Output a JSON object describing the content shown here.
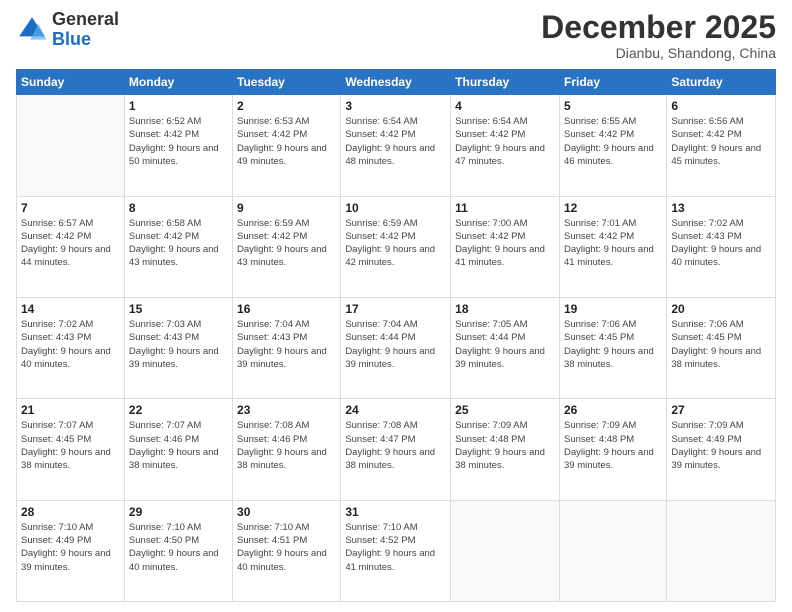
{
  "logo": {
    "general": "General",
    "blue": "Blue"
  },
  "title": "December 2025",
  "subtitle": "Dianbu, Shandong, China",
  "days_of_week": [
    "Sunday",
    "Monday",
    "Tuesday",
    "Wednesday",
    "Thursday",
    "Friday",
    "Saturday"
  ],
  "weeks": [
    [
      {
        "day": "",
        "empty": true
      },
      {
        "day": "1",
        "sunrise": "6:52 AM",
        "sunset": "4:42 PM",
        "daylight": "9 hours and 50 minutes."
      },
      {
        "day": "2",
        "sunrise": "6:53 AM",
        "sunset": "4:42 PM",
        "daylight": "9 hours and 49 minutes."
      },
      {
        "day": "3",
        "sunrise": "6:54 AM",
        "sunset": "4:42 PM",
        "daylight": "9 hours and 48 minutes."
      },
      {
        "day": "4",
        "sunrise": "6:54 AM",
        "sunset": "4:42 PM",
        "daylight": "9 hours and 47 minutes."
      },
      {
        "day": "5",
        "sunrise": "6:55 AM",
        "sunset": "4:42 PM",
        "daylight": "9 hours and 46 minutes."
      },
      {
        "day": "6",
        "sunrise": "6:56 AM",
        "sunset": "4:42 PM",
        "daylight": "9 hours and 45 minutes."
      }
    ],
    [
      {
        "day": "7",
        "sunrise": "6:57 AM",
        "sunset": "4:42 PM",
        "daylight": "9 hours and 44 minutes."
      },
      {
        "day": "8",
        "sunrise": "6:58 AM",
        "sunset": "4:42 PM",
        "daylight": "9 hours and 43 minutes."
      },
      {
        "day": "9",
        "sunrise": "6:59 AM",
        "sunset": "4:42 PM",
        "daylight": "9 hours and 43 minutes."
      },
      {
        "day": "10",
        "sunrise": "6:59 AM",
        "sunset": "4:42 PM",
        "daylight": "9 hours and 42 minutes."
      },
      {
        "day": "11",
        "sunrise": "7:00 AM",
        "sunset": "4:42 PM",
        "daylight": "9 hours and 41 minutes."
      },
      {
        "day": "12",
        "sunrise": "7:01 AM",
        "sunset": "4:42 PM",
        "daylight": "9 hours and 41 minutes."
      },
      {
        "day": "13",
        "sunrise": "7:02 AM",
        "sunset": "4:43 PM",
        "daylight": "9 hours and 40 minutes."
      }
    ],
    [
      {
        "day": "14",
        "sunrise": "7:02 AM",
        "sunset": "4:43 PM",
        "daylight": "9 hours and 40 minutes."
      },
      {
        "day": "15",
        "sunrise": "7:03 AM",
        "sunset": "4:43 PM",
        "daylight": "9 hours and 39 minutes."
      },
      {
        "day": "16",
        "sunrise": "7:04 AM",
        "sunset": "4:43 PM",
        "daylight": "9 hours and 39 minutes."
      },
      {
        "day": "17",
        "sunrise": "7:04 AM",
        "sunset": "4:44 PM",
        "daylight": "9 hours and 39 minutes."
      },
      {
        "day": "18",
        "sunrise": "7:05 AM",
        "sunset": "4:44 PM",
        "daylight": "9 hours and 39 minutes."
      },
      {
        "day": "19",
        "sunrise": "7:06 AM",
        "sunset": "4:45 PM",
        "daylight": "9 hours and 38 minutes."
      },
      {
        "day": "20",
        "sunrise": "7:06 AM",
        "sunset": "4:45 PM",
        "daylight": "9 hours and 38 minutes."
      }
    ],
    [
      {
        "day": "21",
        "sunrise": "7:07 AM",
        "sunset": "4:45 PM",
        "daylight": "9 hours and 38 minutes."
      },
      {
        "day": "22",
        "sunrise": "7:07 AM",
        "sunset": "4:46 PM",
        "daylight": "9 hours and 38 minutes."
      },
      {
        "day": "23",
        "sunrise": "7:08 AM",
        "sunset": "4:46 PM",
        "daylight": "9 hours and 38 minutes."
      },
      {
        "day": "24",
        "sunrise": "7:08 AM",
        "sunset": "4:47 PM",
        "daylight": "9 hours and 38 minutes."
      },
      {
        "day": "25",
        "sunrise": "7:09 AM",
        "sunset": "4:48 PM",
        "daylight": "9 hours and 38 minutes."
      },
      {
        "day": "26",
        "sunrise": "7:09 AM",
        "sunset": "4:48 PM",
        "daylight": "9 hours and 39 minutes."
      },
      {
        "day": "27",
        "sunrise": "7:09 AM",
        "sunset": "4:49 PM",
        "daylight": "9 hours and 39 minutes."
      }
    ],
    [
      {
        "day": "28",
        "sunrise": "7:10 AM",
        "sunset": "4:49 PM",
        "daylight": "9 hours and 39 minutes."
      },
      {
        "day": "29",
        "sunrise": "7:10 AM",
        "sunset": "4:50 PM",
        "daylight": "9 hours and 40 minutes."
      },
      {
        "day": "30",
        "sunrise": "7:10 AM",
        "sunset": "4:51 PM",
        "daylight": "9 hours and 40 minutes."
      },
      {
        "day": "31",
        "sunrise": "7:10 AM",
        "sunset": "4:52 PM",
        "daylight": "9 hours and 41 minutes."
      },
      {
        "day": "",
        "empty": true
      },
      {
        "day": "",
        "empty": true
      },
      {
        "day": "",
        "empty": true
      }
    ]
  ],
  "labels": {
    "sunrise": "Sunrise:",
    "sunset": "Sunset:",
    "daylight": "Daylight:"
  }
}
